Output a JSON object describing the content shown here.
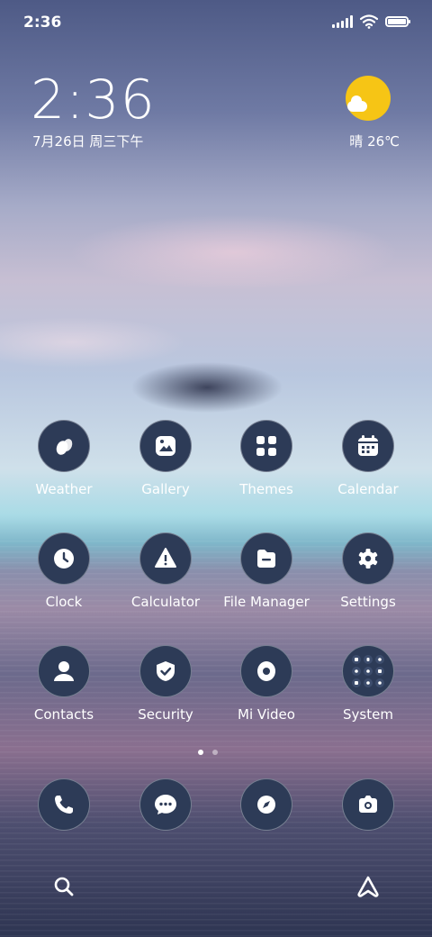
{
  "status_bar": {
    "time": "2:36"
  },
  "clock_widget": {
    "time": "2:36",
    "date": "7月26日 周三下午",
    "weather_text": "晴 26℃",
    "weather_icon": "sun-cloud-icon"
  },
  "apps": [
    {
      "label": "Weather",
      "icon": "weather-icon"
    },
    {
      "label": "Gallery",
      "icon": "gallery-icon"
    },
    {
      "label": "Themes",
      "icon": "themes-icon"
    },
    {
      "label": "Calendar",
      "icon": "calendar-icon"
    },
    {
      "label": "Clock",
      "icon": "clock-icon"
    },
    {
      "label": "Calculator",
      "icon": "calculator-icon"
    },
    {
      "label": "File Manager",
      "icon": "file-manager-icon"
    },
    {
      "label": "Settings",
      "icon": "settings-icon"
    },
    {
      "label": "Contacts",
      "icon": "contacts-icon"
    },
    {
      "label": "Security",
      "icon": "security-icon"
    },
    {
      "label": "Mi Video",
      "icon": "mi-video-icon"
    },
    {
      "label": "System",
      "icon": "system-folder-icon"
    }
  ],
  "dock": [
    {
      "icon": "phone-icon"
    },
    {
      "icon": "messages-icon"
    },
    {
      "icon": "browser-icon"
    },
    {
      "icon": "camera-icon"
    }
  ],
  "page_indicator": {
    "pages": 2,
    "current": 1
  },
  "bottom_bar": {
    "left_icon": "search-icon",
    "right_icon": "assistant-icon"
  },
  "colors": {
    "icon_bg": "#2d3b57",
    "sun": "#f6c515"
  }
}
